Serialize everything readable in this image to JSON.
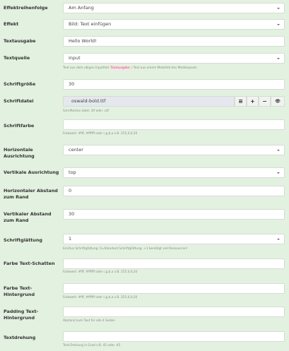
{
  "fields": {
    "order": {
      "label": "Effektreihenfolge",
      "value": "Am Anfang"
    },
    "effect": {
      "label": "Effekt",
      "value": "Bild: Text einfügen"
    },
    "text_output": {
      "label": "Textausgabe",
      "value": "Hello World!"
    },
    "text_source": {
      "label": "Textquelle",
      "value": "input",
      "help_pre": "Text aus dem obigen Inputfeld",
      "help_code": "Textausgabe",
      "help_post": "/ Text aus einem Metafeld des Medienpools"
    },
    "font_size": {
      "label": "Schriftgröße",
      "value": "30"
    },
    "font_file": {
      "label": "Schriftdatei",
      "value": "oswald-bold.ttf",
      "help": "Schriftarten.datei .ttf oder .otf",
      "btn_list": "≡",
      "btn_add": "+",
      "btn_remove": "−",
      "btn_view": "👁"
    },
    "font_color": {
      "label": "Schriftfarbe",
      "value": "",
      "help": "Farbwert: #fff, #ffffff oder r,g,b,a z.B. 255,0,0,20"
    },
    "h_align": {
      "label": "Horizontale Ausrichtung",
      "value": "center"
    },
    "v_align": {
      "label": "Vertikale Ausrichtung",
      "value": "top"
    },
    "h_margin": {
      "label": "Horizontaler Abstand zum Rand",
      "value": "0"
    },
    "v_margin": {
      "label": "Vertikaler Abstand zum Rand",
      "value": "30"
    },
    "smoothing": {
      "label": "Schriftglättung",
      "value": "1",
      "help": "Ein/Aus Schriftglättung: 0=Standard Schriftglättung, >1 benötigt viel Ressourcen!"
    },
    "shadow_color": {
      "label": "Farbe Text-Schatten",
      "value": "",
      "help": "Farbwert: #fff, #ffffff oder r,g,b,a z.B. 255,0,0,20"
    },
    "bg_color": {
      "label": "Farbe Text-Hintergrund",
      "value": "",
      "help": "Farbwert: #fff, #ffffff oder r,g,b,a z.B. 255,0,0,20"
    },
    "padding": {
      "label": "Padding Text-Hintergrund",
      "value": "",
      "help": "Abstand zum Text für alle 4 Seiten"
    },
    "rotation": {
      "label": "Textdrehung",
      "value": "",
      "help": "Text-Drehung in Grad z.B. 45 oder -45"
    }
  }
}
